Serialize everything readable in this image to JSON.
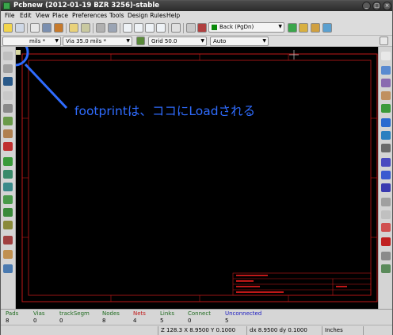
{
  "window": {
    "title": "Pcbnew (2012-01-19 BZR 3256)-stable"
  },
  "menu": [
    "File",
    "Edit",
    "View",
    "Place",
    "Preferences",
    "Tools",
    "Design Rules",
    "Help"
  ],
  "toolbar": {
    "layer_select": "Back (PgDn)",
    "track_width": "mils *",
    "via_size": "Via 35.0 mils *",
    "grid": "Grid 50.0",
    "zoom": "Auto"
  },
  "annotation": {
    "text": "footprintは、ココにLoadされる",
    "color": "#2f6cff"
  },
  "status": {
    "columns": [
      {
        "label": "Pads",
        "value": "8",
        "label_color": "#1f6b1f"
      },
      {
        "label": "Vias",
        "value": "0",
        "label_color": "#1f6b1f"
      },
      {
        "label": "trackSegm",
        "value": "0",
        "label_color": "#1f6b1f"
      },
      {
        "label": "Nodes",
        "value": "8",
        "label_color": "#1f6b1f"
      },
      {
        "label": "Nets",
        "value": "4",
        "label_color": "#c01818"
      },
      {
        "label": "Links",
        "value": "5",
        "label_color": "#1f6b1f"
      },
      {
        "label": "Connect",
        "value": "0",
        "label_color": "#1f6b1f"
      },
      {
        "label": "Unconnected",
        "value": "5",
        "label_color": "#1818c0"
      }
    ],
    "zoom_coords": "Z 128.3  X 8.9500  Y 0.1000",
    "delta": "dx 8.9500  dy 0.1000",
    "units": "Inches"
  },
  "colors": {
    "canvas_bg": "#000000",
    "sheet_border": "#c01818",
    "highlight_ring": "#2f6cff"
  },
  "icons": {
    "left_tools": [
      "show-grid-icon",
      "polar-coords-icon",
      "inch-units-icon",
      "mm-units-icon",
      "cursor-shape-icon",
      "ratsnest-icon",
      "module-ratsnest-icon",
      "auto-delete-track-icon",
      "zone-fill-icon",
      "zone-outline-icon",
      "pads-sketch-icon",
      "vias-sketch-icon",
      "tracks-sketch-icon",
      "high-contrast-icon",
      "microwave-toolbar-icon",
      "layers-manager-icon",
      "show-extra-icon"
    ],
    "right_tools": [
      "select-icon",
      "highlight-net-icon",
      "local-ratsnest-icon",
      "module-add-icon",
      "track-add-icon",
      "via-add-icon",
      "zone-add-icon",
      "keepout-icon",
      "line-add-icon",
      "circle-add-icon",
      "arc-add-icon",
      "text-add-icon",
      "dimension-icon",
      "target-add-icon",
      "delete-icon",
      "offset-origin-icon",
      "grid-origin-icon"
    ]
  }
}
